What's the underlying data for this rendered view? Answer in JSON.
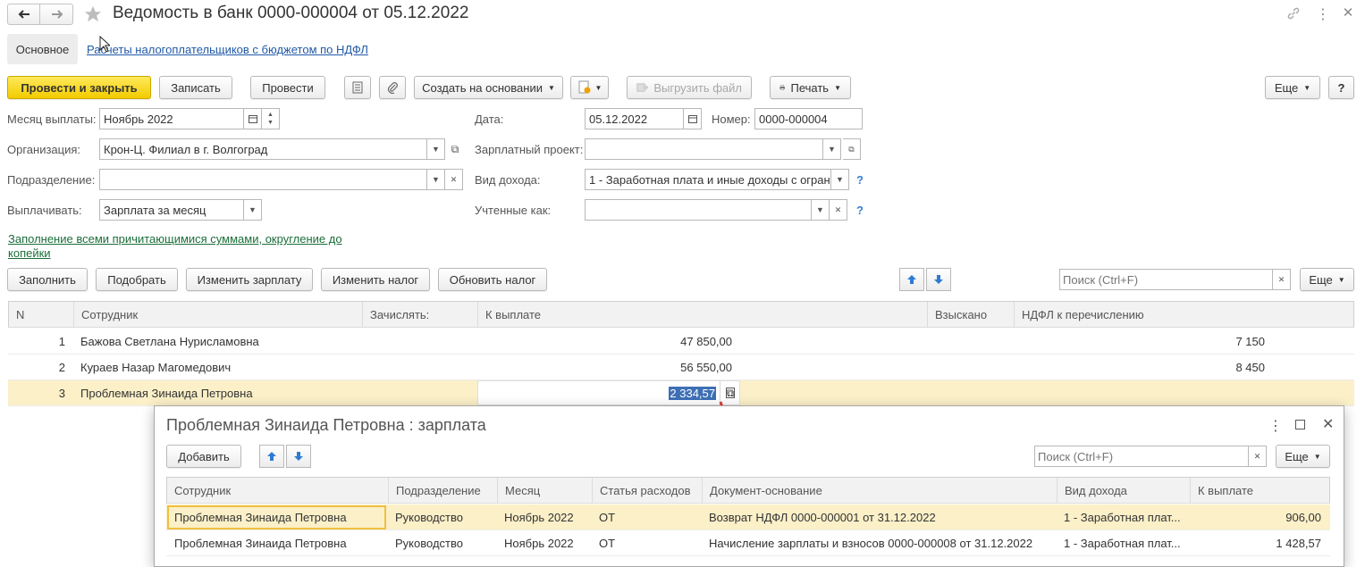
{
  "window": {
    "title": "Ведомость в банк 0000-000004 от 05.12.2022"
  },
  "tabs": {
    "main": "Основное",
    "ndfl_link": "Расчеты налогоплательщиков с бюджетом по НДФЛ"
  },
  "toolbar": {
    "post_close": "Провести и закрыть",
    "save": "Записать",
    "post": "Провести",
    "create_based": "Создать на основании",
    "export_file": "Выгрузить файл",
    "print": "Печать",
    "more": "Еще",
    "help": "?"
  },
  "form": {
    "month_label": "Месяц выплаты:",
    "month_value": "Ноябрь 2022",
    "date_label": "Дата:",
    "date_value": "05.12.2022",
    "number_label": "Номер:",
    "number_value": "0000-000004",
    "org_label": "Организация:",
    "org_value": "Крон-Ц. Филиал в г. Волгоград",
    "salary_project_label": "Зарплатный проект:",
    "salary_project_value": "",
    "dept_label": "Подразделение:",
    "dept_value": "",
    "income_type_label": "Вид дохода:",
    "income_type_value": "1 - Заработная плата и иные доходы с огран",
    "pay_label": "Выплачивать:",
    "pay_value": "Зарплата за месяц",
    "accounted_label": "Учтенные как:",
    "accounted_value": "",
    "help": "?",
    "fill_link_line1": "Заполнение всеми причитающимися суммами, округление до",
    "fill_link_line2": "копейки"
  },
  "table_toolbar": {
    "fill": "Заполнить",
    "pick": "Подобрать",
    "change_salary": "Изменить зарплату",
    "change_tax": "Изменить налог",
    "update_tax": "Обновить налог",
    "search_placeholder": "Поиск (Ctrl+F)",
    "more": "Еще"
  },
  "table": {
    "headers": [
      "N",
      "Сотрудник",
      "Зачислять:",
      "К выплате",
      "Взыскано",
      "НДФЛ к перечислению"
    ],
    "rows": [
      {
        "n": "1",
        "employee": "Бажова Светлана Нурисламовна",
        "credit": "",
        "to_pay": "47 850,00",
        "collected": "",
        "ndfl": "7 150"
      },
      {
        "n": "2",
        "employee": "Кураев Назар Магомедович",
        "credit": "",
        "to_pay": "56 550,00",
        "collected": "",
        "ndfl": "8 450"
      },
      {
        "n": "3",
        "employee": "Проблемная Зинаида Петровна",
        "credit": "",
        "to_pay": "2 334,57",
        "collected": "",
        "ndfl": ""
      }
    ]
  },
  "popup": {
    "title": "Проблемная Зинаида Петровна : зарплата",
    "add": "Добавить",
    "search_placeholder": "Поиск (Ctrl+F)",
    "more": "Еще",
    "headers": [
      "Сотрудник",
      "Подразделение",
      "Месяц",
      "Статья расходов",
      "Документ-основание",
      "Вид дохода",
      "К выплате"
    ],
    "rows": [
      {
        "employee": "Проблемная Зинаида Петровна",
        "dept": "Руководство",
        "month": "Ноябрь 2022",
        "expense": "ОТ",
        "doc": "Возврат НДФЛ 0000-000001 от 31.12.2022",
        "income": "1 - Заработная плат...",
        "to_pay": "906,00"
      },
      {
        "employee": "Проблемная Зинаида Петровна",
        "dept": "Руководство",
        "month": "Ноябрь 2022",
        "expense": "ОТ",
        "doc": "Начисление зарплаты и взносов 0000-000008 от 31.12.2022",
        "income": "1 - Заработная плат...",
        "to_pay": "1 428,57"
      }
    ]
  },
  "colors": {
    "primary_button": "#f2cc00",
    "selected_row": "#fbf0c8",
    "selection": "#3d6fb6",
    "annotation_arrow": "#e23b3b",
    "link_green": "#1b6e3a",
    "link_blue": "#2159a8"
  },
  "icons": [
    "back-arrow-icon",
    "forward-arrow-icon",
    "star-icon",
    "link-icon",
    "kebab-menu-icon",
    "close-icon",
    "list-icon",
    "paperclip-icon",
    "document-icon",
    "printer-icon",
    "calendar-icon",
    "open-icon",
    "up-arrow-icon",
    "down-arrow-icon",
    "maximize-icon",
    "calculator-icon",
    "mouse-cursor-icon"
  ]
}
